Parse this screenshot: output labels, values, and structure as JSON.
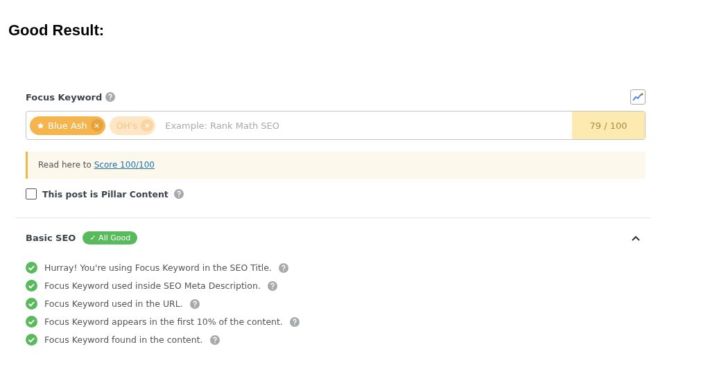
{
  "heading": "Good Result:",
  "focus_keyword": {
    "label": "Focus Keyword",
    "keywords": [
      {
        "text": "Blue Ash",
        "primary": true
      },
      {
        "text": "OH's",
        "primary": false
      }
    ],
    "placeholder": "Example: Rank Math SEO",
    "score": "79 / 100"
  },
  "notice": {
    "text": "Read here to ",
    "link": "Score 100/100"
  },
  "pillar": {
    "label": "This post is Pillar Content",
    "checked": false
  },
  "section": {
    "title": "Basic SEO",
    "badge": "✓ All Good",
    "expanded": true,
    "tests": [
      {
        "text": "Hurray! You're using Focus Keyword in the SEO Title.",
        "passed": true
      },
      {
        "text": "Focus Keyword used inside SEO Meta Description.",
        "passed": true
      },
      {
        "text": "Focus Keyword used in the URL.",
        "passed": true
      },
      {
        "text": "Focus Keyword appears in the first 10% of the content.",
        "passed": true
      },
      {
        "text": "Focus Keyword found in the content.",
        "passed": true
      }
    ]
  }
}
